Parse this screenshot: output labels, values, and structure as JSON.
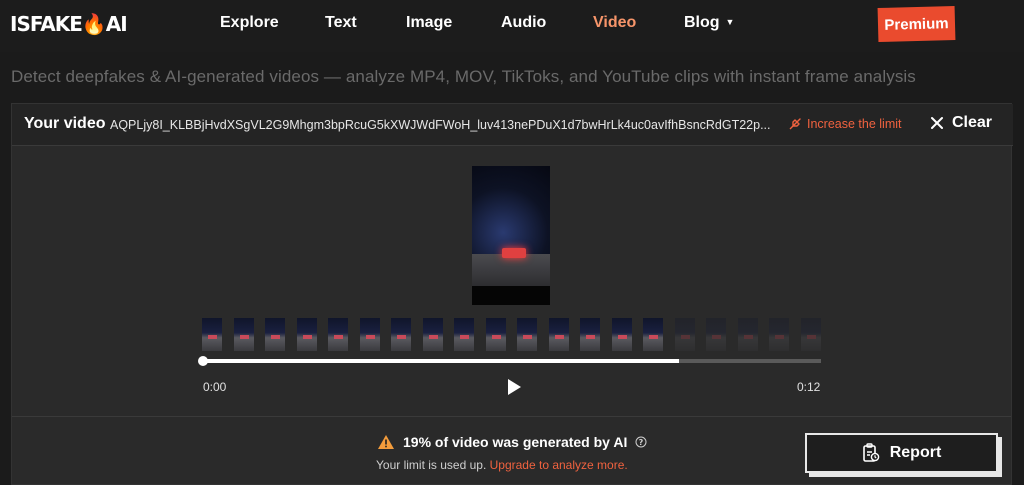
{
  "brand": {
    "logo_left": "ISFAKE",
    "logo_flame": "🔥",
    "logo_right": "AI",
    "accent": "#ea4b2e"
  },
  "nav": {
    "items": [
      {
        "label": "Explore"
      },
      {
        "label": "Text"
      },
      {
        "label": "Image"
      },
      {
        "label": "Audio"
      },
      {
        "label": "Video",
        "active": true
      },
      {
        "label": "Blog"
      }
    ],
    "premium_label": "Premium"
  },
  "tagline": "Detect deepfakes & AI-generated videos — analyze MP4, MOV, TikToks, and YouTube clips with instant frame analysis",
  "panel": {
    "title": "Your video",
    "file_name": "AQPLjy8I_KLBBjHvdXSgVL2G9Mhgm3bpRcuG5kXWJWdFWoH_luv413nePDuX1d7bwHrLk4uc0avIfhBsncRdGT22p...",
    "increase_label": "Increase the limit",
    "clear_label": "Clear"
  },
  "player": {
    "time_start": "0:00",
    "time_end": "0:12",
    "progress": 0.77,
    "frame_count": 20,
    "analyzed_frames": 15
  },
  "result": {
    "text": "19% of video was generated by AI",
    "limit_text": "Your limit is used up.",
    "upgrade_text": "Upgrade to analyze more.",
    "warning_color": "#f39c3c"
  },
  "report": {
    "label": "Report"
  }
}
